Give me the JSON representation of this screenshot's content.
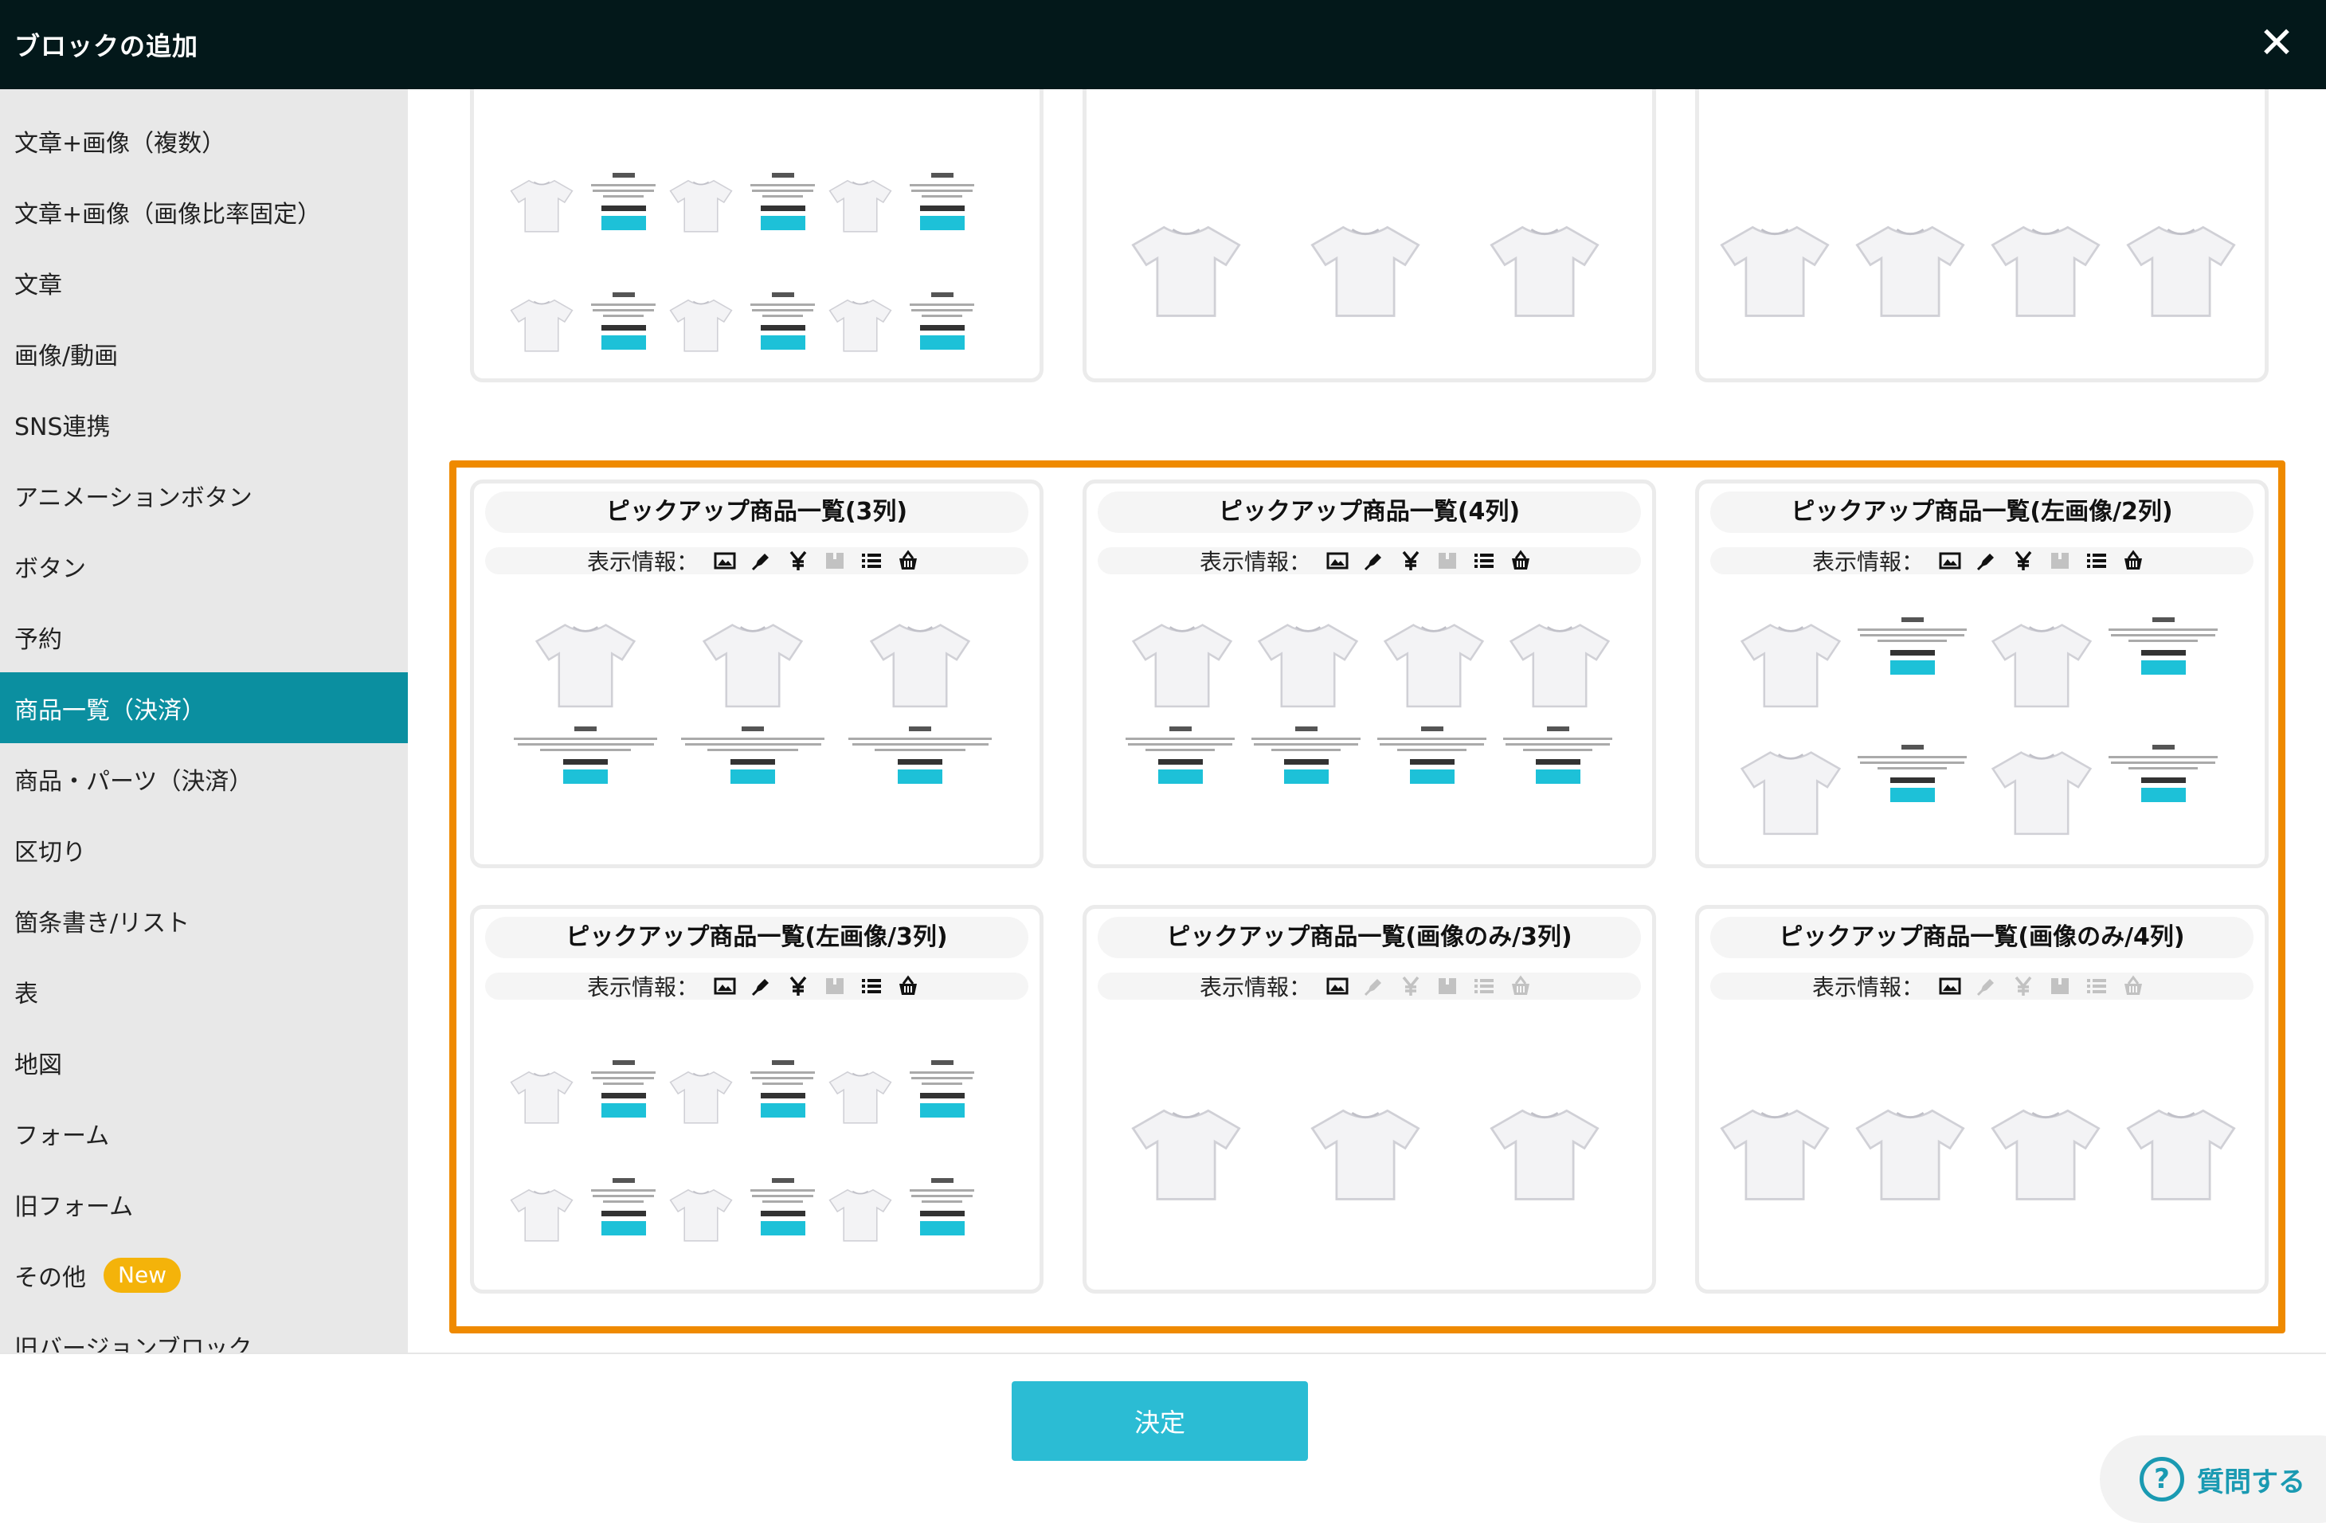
{
  "header": {
    "title": "ブロックの追加",
    "close_symbol": "✕"
  },
  "sidebar": {
    "items": [
      {
        "label": "文章+画像（複数）"
      },
      {
        "label": "文章+画像（画像比率固定）"
      },
      {
        "label": "文章"
      },
      {
        "label": "画像/動画"
      },
      {
        "label": "SNS連携"
      },
      {
        "label": "アニメーションボタン"
      },
      {
        "label": "ボタン"
      },
      {
        "label": "予約"
      },
      {
        "label": "商品一覧（決済）",
        "active": true
      },
      {
        "label": "商品・パーツ（決済）"
      },
      {
        "label": "区切り"
      },
      {
        "label": "箇条書き/リスト"
      },
      {
        "label": "表"
      },
      {
        "label": "地図"
      },
      {
        "label": "フォーム"
      },
      {
        "label": "旧フォーム"
      },
      {
        "label": "その他",
        "badge": "New"
      },
      {
        "label": "旧バージョンブロック"
      }
    ]
  },
  "cards": {
    "info_label": "表示情報：",
    "items": [
      {
        "title": "ピックアップ商品一覧(3列)",
        "info_flags": [
          1,
          1,
          1,
          0,
          1,
          1
        ]
      },
      {
        "title": "ピックアップ商品一覧(4列)",
        "info_flags": [
          1,
          1,
          1,
          0,
          1,
          1
        ]
      },
      {
        "title": "ピックアップ商品一覧(左画像/2列)",
        "info_flags": [
          1,
          1,
          1,
          0,
          1,
          1
        ]
      },
      {
        "title": "ピックアップ商品一覧(左画像/3列)",
        "info_flags": [
          1,
          1,
          1,
          0,
          1,
          1
        ]
      },
      {
        "title": "ピックアップ商品一覧(画像のみ/3列)",
        "info_flags": [
          1,
          0,
          0,
          0,
          0,
          0
        ]
      },
      {
        "title": "ピックアップ商品一覧(画像のみ/4列)",
        "info_flags": [
          1,
          0,
          0,
          0,
          0,
          0
        ]
      }
    ],
    "info_icons": [
      "image-icon",
      "pen-icon",
      "yen-icon",
      "box-icon",
      "list-icon",
      "basket-icon"
    ]
  },
  "footer": {
    "submit_label": "決定",
    "help_label": "質問する",
    "help_symbol": "?"
  },
  "colors": {
    "header_bg": "#03181a",
    "active_item": "#0b8fa0",
    "accent": "#2bbcd4",
    "selection": "#ef8a00",
    "badge": "#f4b30a"
  }
}
